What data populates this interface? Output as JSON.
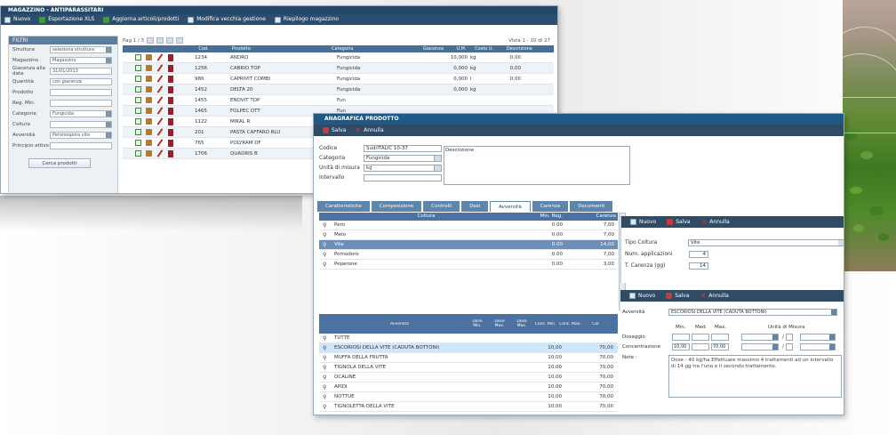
{
  "w1": {
    "title": "MAGAZZINO - ANTIPARASSITARI",
    "toolbar": [
      {
        "icon": "new-doc-icon",
        "label": "Nuovo"
      },
      {
        "icon": "excel-icon",
        "label": "Esportazione XLS"
      },
      {
        "icon": "refresh-icon",
        "label": "Aggiorna articoli/prodotti"
      },
      {
        "icon": "move-icon",
        "label": "Modifica vecchia gestione"
      },
      {
        "icon": "warehouse-icon",
        "label": "Riepilogo magazzino"
      }
    ],
    "filter": {
      "title": "FILTRI",
      "rows": [
        {
          "label": "Struttura",
          "value": "seleziona struttura",
          "select": true
        },
        {
          "label": "Magazzino",
          "value": "Magazzino",
          "select": true
        },
        {
          "label": "Giacenza alla data",
          "value": "31/01/2013",
          "select": false
        },
        {
          "label": "Quantità",
          "value": "con giacenza",
          "select": false
        },
        {
          "label": "Prodotto",
          "value": "",
          "select": false
        },
        {
          "label": "Reg. Min.",
          "value": "",
          "select": false
        },
        {
          "label": "Categoria",
          "value": "Fungicida",
          "select": true
        },
        {
          "label": "Coltura",
          "value": "",
          "select": true
        },
        {
          "label": "Avversità",
          "value": "Peronospora vite",
          "select": true
        },
        {
          "label": "Principio attivo",
          "value": "",
          "select": false
        }
      ],
      "button": "Cerca prodotti"
    },
    "pager": {
      "left": "Pag 1 / 3",
      "right": "Vista 1 - 10 di 27"
    },
    "columns": [
      "",
      "Cod.",
      "Prodotto",
      "Categoria",
      "Giacenza",
      "U.M.",
      "Costo U.",
      "Descrizione"
    ],
    "rows": [
      {
        "code": "1234",
        "name": "ANDRO",
        "cat": "Fungicida",
        "qty": "10,000",
        "um": "kg",
        "cost": "0,00"
      },
      {
        "code": "1256",
        "name": "CABRIO TOP",
        "cat": "Fungicida",
        "qty": "0,000",
        "um": "kg",
        "cost": "0,00"
      },
      {
        "code": "986",
        "name": "CAPRIVIT COMBI",
        "cat": "Fungicida",
        "qty": "0,000",
        "um": "l",
        "cost": "0,00"
      },
      {
        "code": "1452",
        "name": "DELTA 20",
        "cat": "Fungicida",
        "qty": "0,000",
        "um": "kg",
        "cost": ""
      },
      {
        "code": "1455",
        "name": "ENOVIT TOP",
        "cat": "Fun",
        "qty": "",
        "um": "",
        "cost": ""
      },
      {
        "code": "1465",
        "name": "FOLPEC DTT",
        "cat": "Fun",
        "qty": "",
        "um": "",
        "cost": ""
      },
      {
        "code": "1122",
        "name": "MIKAL R",
        "cat": "Fun",
        "qty": "",
        "um": "",
        "cost": ""
      },
      {
        "code": "201",
        "name": "PASTA CAFFARO BLU",
        "cat": "Fun",
        "qty": "",
        "um": "",
        "cost": ""
      },
      {
        "code": "765",
        "name": "POLYRAM DF",
        "cat": "Fun",
        "qty": "",
        "um": "",
        "cost": ""
      },
      {
        "code": "1706",
        "name": "QUADRIS B",
        "cat": "Fun",
        "qty": "",
        "um": "",
        "cost": ""
      }
    ]
  },
  "w2": {
    "title": "ANAGRAFICA PRODOTTO",
    "toolbar": [
      {
        "label": "Salva"
      },
      {
        "label": "Annulla"
      }
    ],
    "fields": [
      {
        "label": "Codice",
        "value": "Sud/ITALIC 10-37",
        "select": false
      },
      {
        "label": "Categoria",
        "value": "Fungicida",
        "select": true
      },
      {
        "label": "Unità di misura",
        "value": "kg",
        "select": true
      },
      {
        "label": "Intervallo",
        "value": "",
        "select": false
      }
    ],
    "desc_label": "Descrizione",
    "tabs": [
      "Caratteristiche",
      "Composizione",
      "Controlli",
      "Dosi",
      "Avversità",
      "Carenza",
      "Documenti"
    ],
    "gridA": {
      "columns": [
        "",
        "Coltura",
        "Min. Reg.",
        "Carenza"
      ],
      "rows": [
        {
          "name": "Pero",
          "min": "0.00",
          "car": "7,00",
          "style": ""
        },
        {
          "name": "Melo",
          "min": "0.00",
          "car": "7,00",
          "style": ""
        },
        {
          "name": "Vite",
          "min": "0.00",
          "car": "14,00",
          "style": "sel"
        },
        {
          "name": "Pomodoro",
          "min": "0.00",
          "car": "7,00",
          "style": ""
        },
        {
          "name": "Peperone",
          "min": "0.00",
          "car": "3,00",
          "style": ""
        }
      ]
    },
    "gridB": {
      "columns": [
        "",
        "Avversità",
        "Dose Min.",
        "Dose Max.",
        "Dose Max.",
        "Conc. Min.",
        "Conc. Max.",
        "Car."
      ],
      "rows": [
        {
          "name": "TUTTE",
          "a": "",
          "b": "",
          "style": ""
        },
        {
          "name": "ESCORIOSI DELLA VITE (CADUTA BOTTONI)",
          "a": "10,00",
          "b": "70,00",
          "style": "hl"
        },
        {
          "name": "MUFFA DELLA FRUTTA",
          "a": "10,00",
          "b": "70,00",
          "style": ""
        },
        {
          "name": "TIGNOLA DELLA VITE",
          "a": "10,00",
          "b": "70,00",
          "style": ""
        },
        {
          "name": "OCALINE",
          "a": "10,00",
          "b": "70,00",
          "style": ""
        },
        {
          "name": "APIDI",
          "a": "10,00",
          "b": "70,00",
          "style": ""
        },
        {
          "name": "NOTTUE",
          "a": "10,00",
          "b": "70,00",
          "style": ""
        },
        {
          "name": "TIGNOLETTA DELLA VITE",
          "a": "10,00",
          "b": "70,00",
          "style": ""
        }
      ]
    }
  },
  "sub1": {
    "toolbar": [
      {
        "label": "Nuovo"
      },
      {
        "label": "Salva"
      },
      {
        "label": "Annulla"
      }
    ],
    "fields": [
      {
        "label": "Tipo Coltura",
        "value": "Vite"
      },
      {
        "label": "Num. applicazioni",
        "value": "4"
      },
      {
        "label": "T. Carenza (gg)",
        "value": "14"
      }
    ]
  },
  "sub2": {
    "toolbar": [
      {
        "label": "Nuovo"
      },
      {
        "label": "Salva"
      },
      {
        "label": "Annulla"
      }
    ],
    "avv_label": "Avversità",
    "avv_value": "ESCORIOSI DELLA VITE (CADUTA BOTTONI)",
    "col_headers": [
      "Min.",
      "Med.",
      "Max.",
      "Unità di Misura"
    ],
    "dose_label": "Dosaggio",
    "conc_label": "Concentrazione",
    "note_label": "Note :",
    "conc_min": "10,00",
    "conc_max": "70,00",
    "note_text": "Dose - 40 kg/ha Effettuare massimo 4 trattamenti ad un intervallo di 14 gg tra l'uno e il secondo trattamento."
  }
}
